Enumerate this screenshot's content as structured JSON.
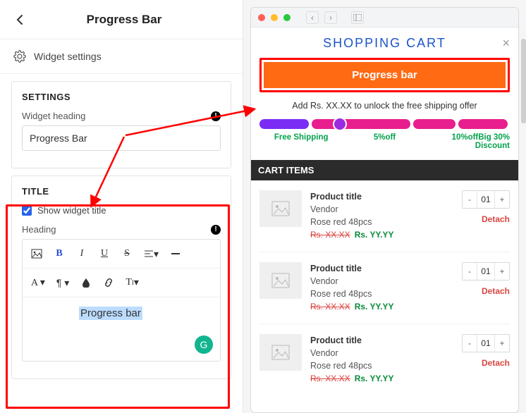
{
  "panel": {
    "title": "Progress Bar",
    "widget_settings": "Widget settings"
  },
  "settings": {
    "heading": "SETTINGS",
    "widget_heading_label": "Widget heading",
    "widget_heading_value": "Progress Bar"
  },
  "title_section": {
    "heading": "TITLE",
    "show_widget_label": "Show widget title",
    "show_widget_checked": true,
    "heading_label": "Heading",
    "editor_value": "Progress bar"
  },
  "preview": {
    "cart_title": "SHOPPING CART",
    "orange_banner": "Progress bar",
    "unlock_text": "Add Rs. XX.XX to unlock the free shipping offer",
    "tiers": {
      "t1": "Free Shipping",
      "t2": "5%off",
      "t3": "10%offBig 30% Discount"
    },
    "cart_items_heading": "CART ITEMS",
    "items": [
      {
        "title": "Product title",
        "vendor": "Vendor",
        "variant": "Rose red 48pcs",
        "old": "Rs. XX.XX",
        "new": "Rs. YY.YY",
        "qty": "01",
        "detach": "Detach"
      },
      {
        "title": "Product title",
        "vendor": "Vendor",
        "variant": "Rose red 48pcs",
        "old": "Rs. XX.XX",
        "new": "Rs. YY.YY",
        "qty": "01",
        "detach": "Detach"
      },
      {
        "title": "Product title",
        "vendor": "Vendor",
        "variant": "Rose red 48pcs",
        "old": "Rs. XX.XX",
        "new": "Rs. YY.YY",
        "qty": "01",
        "detach": "Detach"
      }
    ]
  }
}
